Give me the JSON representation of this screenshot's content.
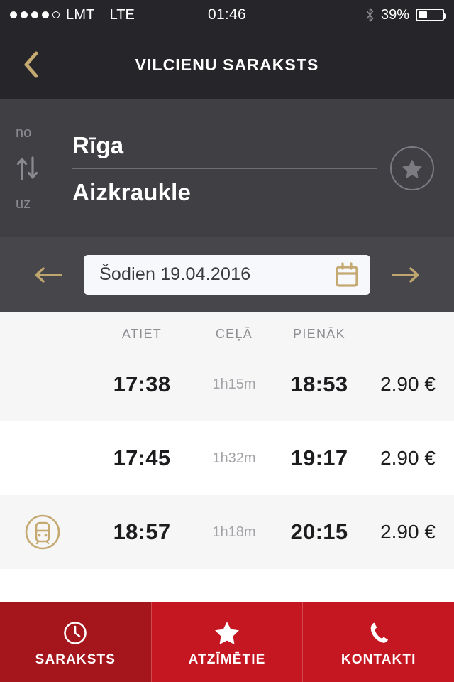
{
  "statusbar": {
    "signal_dots_filled": 4,
    "signal_dots_total": 5,
    "carrier": "LMT",
    "network": "LTE",
    "time": "01:46",
    "bluetooth_icon": "bluetooth-icon",
    "battery_percent": "39%",
    "battery_level": 39
  },
  "navbar": {
    "back_icon": "chevron-left-icon",
    "title": "VILCIENU SARAKSTS"
  },
  "route": {
    "from_label": "no",
    "from_value": "Rīga",
    "to_label": "uz",
    "to_value": "Aizkraukle",
    "swap_icon": "swap-vertical-icon",
    "favorite_icon": "star-icon"
  },
  "datebar": {
    "prev_icon": "arrow-left-icon",
    "next_icon": "arrow-right-icon",
    "date_text": "Šodien 19.04.2016",
    "calendar_icon": "calendar-icon"
  },
  "schedule": {
    "headers": {
      "depart": "ATIET",
      "duration": "CEĻĀ",
      "arrive": "PIENĀK",
      "price": ""
    },
    "rows": [
      {
        "icon": "",
        "depart": "17:38",
        "duration": "1h15m",
        "arrive": "18:53",
        "price": "2.90 €"
      },
      {
        "icon": "",
        "depart": "17:45",
        "duration": "1h32m",
        "arrive": "19:17",
        "price": "2.90 €"
      },
      {
        "icon": "train-icon",
        "depart": "18:57",
        "duration": "1h18m",
        "arrive": "20:15",
        "price": "2.90 €"
      }
    ]
  },
  "tabbar": {
    "tabs": [
      {
        "label": "SARAKSTS",
        "icon": "clock-icon",
        "active": true
      },
      {
        "label": "ATZĪMĒTIE",
        "icon": "star-icon",
        "active": false
      },
      {
        "label": "KONTAKTI",
        "icon": "phone-icon",
        "active": false
      }
    ]
  },
  "colors": {
    "header_dark": "#26262A",
    "route_panel": "#403F44",
    "date_panel": "#47474B",
    "gold": "#C4A971",
    "tab_active_red": "#A4151C",
    "tab_red": "#C41721",
    "row_alt": "#F7F6F7"
  }
}
